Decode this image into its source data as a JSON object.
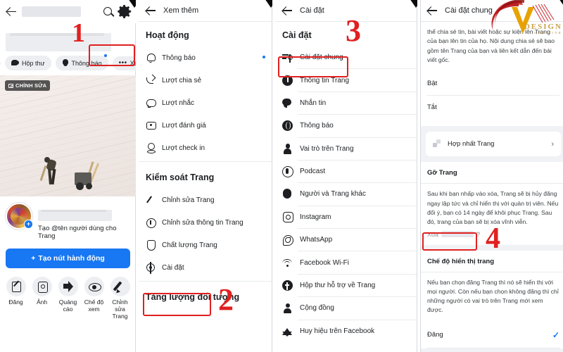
{
  "panel1": {
    "topbar": {
      "search_icon": "search-icon",
      "gear_icon": "gear-icon",
      "back_icon": "back-arrow-icon"
    },
    "chips": [
      {
        "label": "",
        "icon": "clipped-chip",
        "has_badge": false
      },
      {
        "label": "Hộp thư",
        "icon": "inbox-icon",
        "has_badge": false
      },
      {
        "label": "Thông báo",
        "icon": "bell-icon",
        "has_badge": true
      },
      {
        "label": "Xem thêm",
        "icon": "dots-icon",
        "has_badge": true
      }
    ],
    "cover": {
      "edit_badge": "CHỈNH SỬA",
      "edit_icon": "camera-icon"
    },
    "profile": {
      "username_prompt": "Tạo @tên người dùng cho Trang",
      "plus": "+"
    },
    "cta": {
      "label": "Tạo nút hành động",
      "plus": "+"
    },
    "actions": [
      {
        "label": "Đăng",
        "icon": "compose-icon"
      },
      {
        "label": "Ảnh",
        "icon": "photo-icon"
      },
      {
        "label": "Quảng cáo",
        "icon": "megaphone-icon"
      },
      {
        "label": "Chế độ xem",
        "icon": "eye-icon"
      },
      {
        "label": "Chỉnh sửa Trang",
        "icon": "pencil-icon"
      }
    ]
  },
  "panel2": {
    "title": "Xem thêm",
    "section1": "Hoạt động",
    "items1": [
      {
        "label": "Thông báo",
        "icon": "bell-icon",
        "badge": true
      },
      {
        "label": "Lượt chia sẻ",
        "icon": "share-icon",
        "badge": false
      },
      {
        "label": "Lượt nhắc",
        "icon": "comment-icon",
        "badge": false
      },
      {
        "label": "Lượt đánh giá",
        "icon": "review-icon",
        "badge": false
      },
      {
        "label": "Lượt check in",
        "icon": "pin-icon",
        "badge": false
      }
    ],
    "section2": "Kiểm soát Trang",
    "items2": [
      {
        "label": "Chỉnh sửa Trang",
        "icon": "pencil-icon"
      },
      {
        "label": "Chỉnh sửa thông tin Trang",
        "icon": "info-icon"
      },
      {
        "label": "Chất lượng Trang",
        "icon": "shield-icon"
      },
      {
        "label": "Cài đặt",
        "icon": "gear-icon"
      }
    ],
    "section3": "Tăng lượng đối tượng"
  },
  "panel3": {
    "title": "Cài đặt",
    "section": "Cài đặt",
    "items": [
      {
        "label": "Cài đặt chung",
        "icon": "sliders-icon"
      },
      {
        "label": "Thông tin Trang",
        "icon": "info-icon"
      },
      {
        "label": "Nhắn tin",
        "icon": "message-icon"
      },
      {
        "label": "Thông báo",
        "icon": "globe-bell-icon"
      },
      {
        "label": "Vai trò trên Trang",
        "icon": "person-icon"
      },
      {
        "label": "Podcast",
        "icon": "podcast-icon"
      },
      {
        "label": "Người và Trang khác",
        "icon": "people-icon"
      },
      {
        "label": "Instagram",
        "icon": "instagram-icon"
      },
      {
        "label": "WhatsApp",
        "icon": "whatsapp-icon"
      },
      {
        "label": "Facebook Wi-Fi",
        "icon": "wifi-icon"
      },
      {
        "label": "Hộp thư hỗ trợ về Trang",
        "icon": "facebook-icon"
      },
      {
        "label": "Cộng đồng",
        "icon": "person-icon"
      },
      {
        "label": "Huy hiệu trên Facebook",
        "icon": "star-icon"
      }
    ]
  },
  "panel4": {
    "title": "Cài đặt chung",
    "share_paragraph": "thể chia sẻ tin, bài viết hoặc sự kiện lên Trang của bạn lên tin của họ. Nội dung chia sẻ sẽ bao gồm tên Trang của bạn và liên kết dẫn đến bài viết gốc.",
    "option_on": "Bật",
    "option_off": "Tắt",
    "merge": {
      "label": "Hợp nhất Trang",
      "chevron": "›",
      "icon": "merge-icon"
    },
    "remove": {
      "title": "Gỡ Trang",
      "paragraph": "Sau khi bạn nhấp vào xóa, Trang sẽ bị hủy đăng ngay lập tức và chỉ hiển thị với quản trị viên. Nếu đổi ý, bạn có 14 ngày để khôi phục Trang. Sau đó, trang của bạn sẽ bị xóa vĩnh viễn.",
      "link_prefix": "Xóa",
      "link_suffix": "?"
    },
    "visibility": {
      "title": "Chế độ hiển thị trang",
      "paragraph": "Nếu bạn chọn đăng Trang thì nó sẽ hiển thị với mọi người. Còn nếu bạn chọn không đăng thì chỉ những người có vai trò trên Trang mới xem được.",
      "option": "Đăng",
      "check": "✓"
    }
  },
  "annotations": {
    "numbers": [
      "1",
      "2",
      "3",
      "4"
    ],
    "accent_color": "#e02020"
  },
  "watermark": {
    "line1": "DESIGN",
    "line2": "CREATIVE"
  },
  "theme": {
    "fb_blue": "#1877f2",
    "text_primary": "#1c1e21",
    "text_secondary": "#65676b",
    "bg_grey": "#f0f2f5",
    "chip_bg": "#eceef1",
    "divider": "#e9ebee"
  }
}
